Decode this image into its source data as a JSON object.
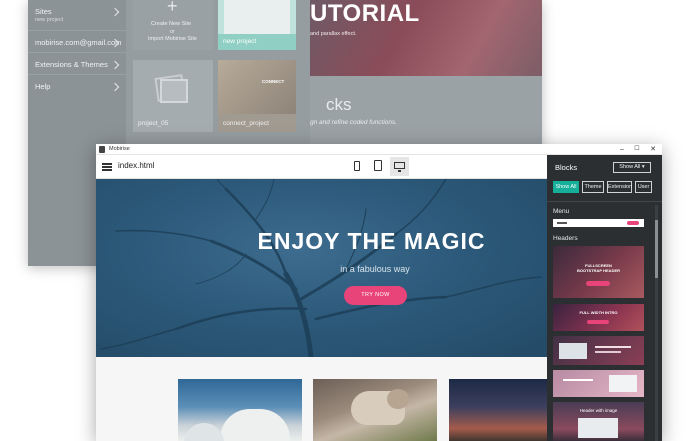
{
  "back_window": {
    "sidebar": {
      "items": [
        {
          "label": "Sites",
          "sub": "new project"
        },
        {
          "label": "mobirise.com@gmail.com"
        },
        {
          "label": "Extensions & Themes"
        },
        {
          "label": "Help"
        }
      ]
    },
    "grid": {
      "create_label": "Create New Site",
      "or_label": "or",
      "import_label": "Import Mobirise Site",
      "tiles": [
        {
          "label": "new project"
        },
        {
          "label": "project_05"
        },
        {
          "label": "connect_project",
          "caption": "CONNECT"
        }
      ]
    },
    "hero": {
      "title": "UTORIAL",
      "subtitle": "and parallax effect."
    },
    "blocks_section": {
      "title": "cks",
      "subtitle": "gn and refine coded functions."
    }
  },
  "window": {
    "title": "Mobirise",
    "controls": {
      "minimize": "–",
      "maximize": "☐",
      "close": "✕"
    }
  },
  "toolbar": {
    "file_name": "index.html",
    "devices": [
      "mobile",
      "tablet",
      "desktop"
    ]
  },
  "hero": {
    "title": "ENJOY THE MAGIC",
    "subtitle": "in a fabulous way",
    "button": "TRY NOW"
  },
  "blocks_panel": {
    "title": "Blocks",
    "dropdown": "Show All ▾",
    "tabs": [
      "Show All",
      "Theme",
      "Extension",
      "User"
    ],
    "sections": {
      "menu": "Menu",
      "headers": "Headers"
    },
    "thumbnails": [
      {
        "caption": "FULLSCREEN BOOTSTRAP HEADER"
      },
      {
        "caption": "FULL WIDTH INTRO"
      },
      {
        "caption": ""
      },
      {
        "caption": ""
      },
      {
        "caption": "Header with image"
      }
    ]
  },
  "colors": {
    "accent_teal": "#16b09a",
    "cta_pink": "#e8447a",
    "panel_bg": "#2b2f32",
    "hero_blue": "#2d5a7b"
  }
}
